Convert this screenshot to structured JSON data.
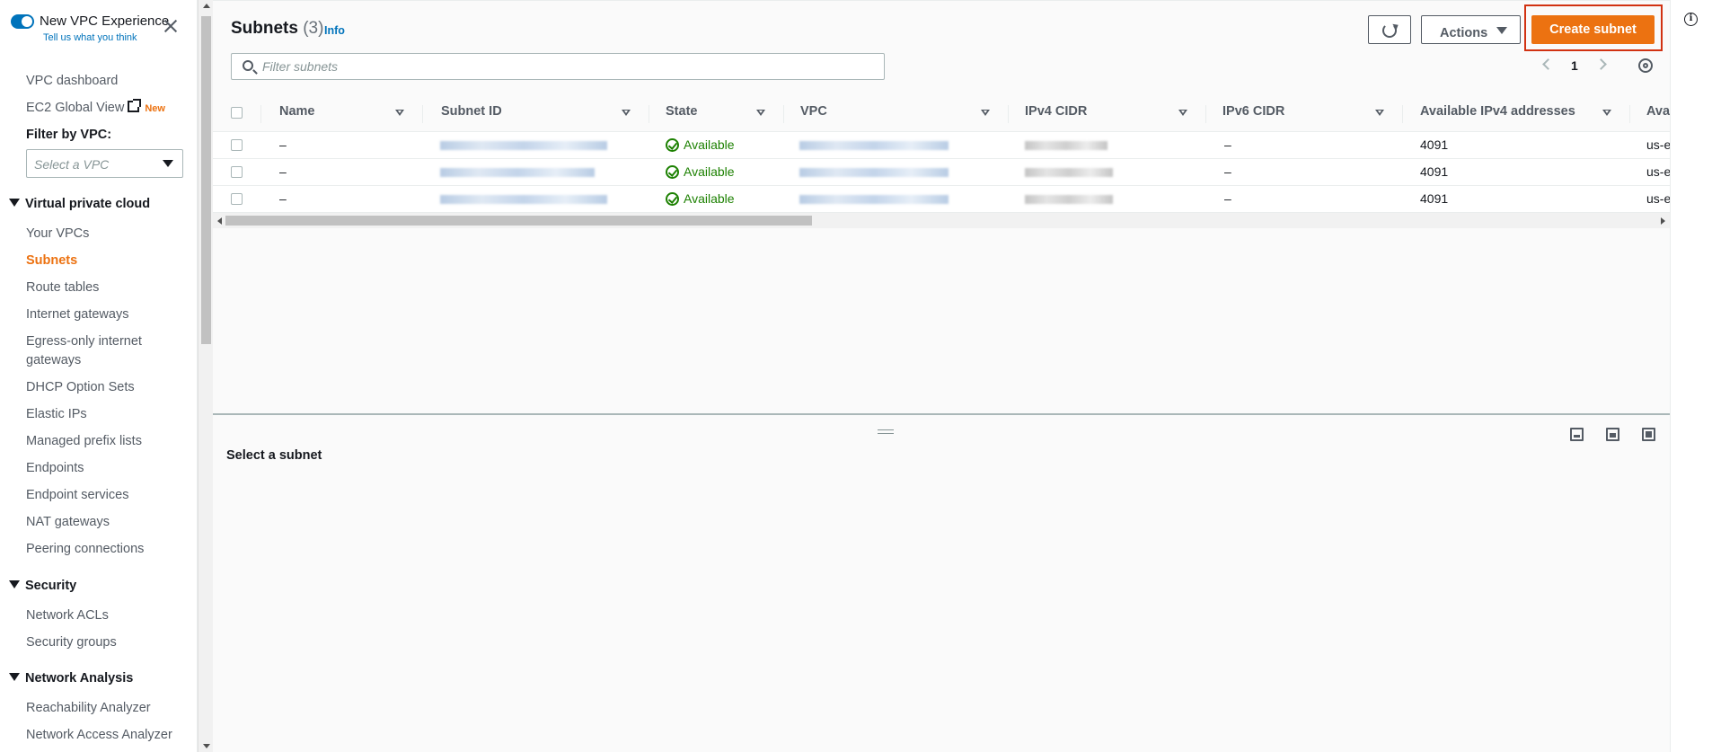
{
  "sidebar": {
    "toggle_title": "New VPC Experience",
    "toggle_subtitle": "Tell us what you think",
    "links": {
      "vpc_dashboard": "VPC dashboard",
      "ec2_global_view": "EC2 Global View",
      "new_badge": "New"
    },
    "filter_label": "Filter by VPC:",
    "filter_placeholder": "Select a VPC",
    "sections": [
      {
        "title": "Virtual private cloud",
        "items": [
          "Your VPCs",
          "Subnets",
          "Route tables",
          "Internet gateways",
          "Egress-only internet",
          "gateways",
          "DHCP Option Sets",
          "Elastic IPs",
          "Managed prefix lists",
          "Endpoints",
          "Endpoint services",
          "NAT gateways",
          "Peering connections"
        ]
      },
      {
        "title": "Security",
        "items": [
          "Network ACLs",
          "Security groups"
        ]
      },
      {
        "title": "Network Analysis",
        "items": [
          "Reachability Analyzer",
          "Network Access Analyzer"
        ]
      }
    ],
    "active_item": "Subnets"
  },
  "header": {
    "title": "Subnets",
    "count": "(3)",
    "info": "Info",
    "actions_label": "Actions",
    "create_label": "Create subnet",
    "filter_placeholder": "Filter subnets",
    "page_number": "1"
  },
  "table": {
    "columns": [
      "Name",
      "Subnet ID",
      "State",
      "VPC",
      "IPv4 CIDR",
      "IPv6 CIDR",
      "Available IPv4 addresses",
      "Avai"
    ],
    "rows": [
      {
        "name": "–",
        "state": "Available",
        "ipv6": "–",
        "available_ipv4": "4091",
        "az": "us-ea"
      },
      {
        "name": "–",
        "state": "Available",
        "ipv6": "–",
        "available_ipv4": "4091",
        "az": "us-ea"
      },
      {
        "name": "–",
        "state": "Available",
        "ipv6": "–",
        "available_ipv4": "4091",
        "az": "us-ea"
      }
    ]
  },
  "details": {
    "empty_label": "Select a subnet"
  },
  "colors": {
    "accent": "#ec7211",
    "link": "#0073bb",
    "success": "#1d8102",
    "highlight": "#d13212"
  }
}
